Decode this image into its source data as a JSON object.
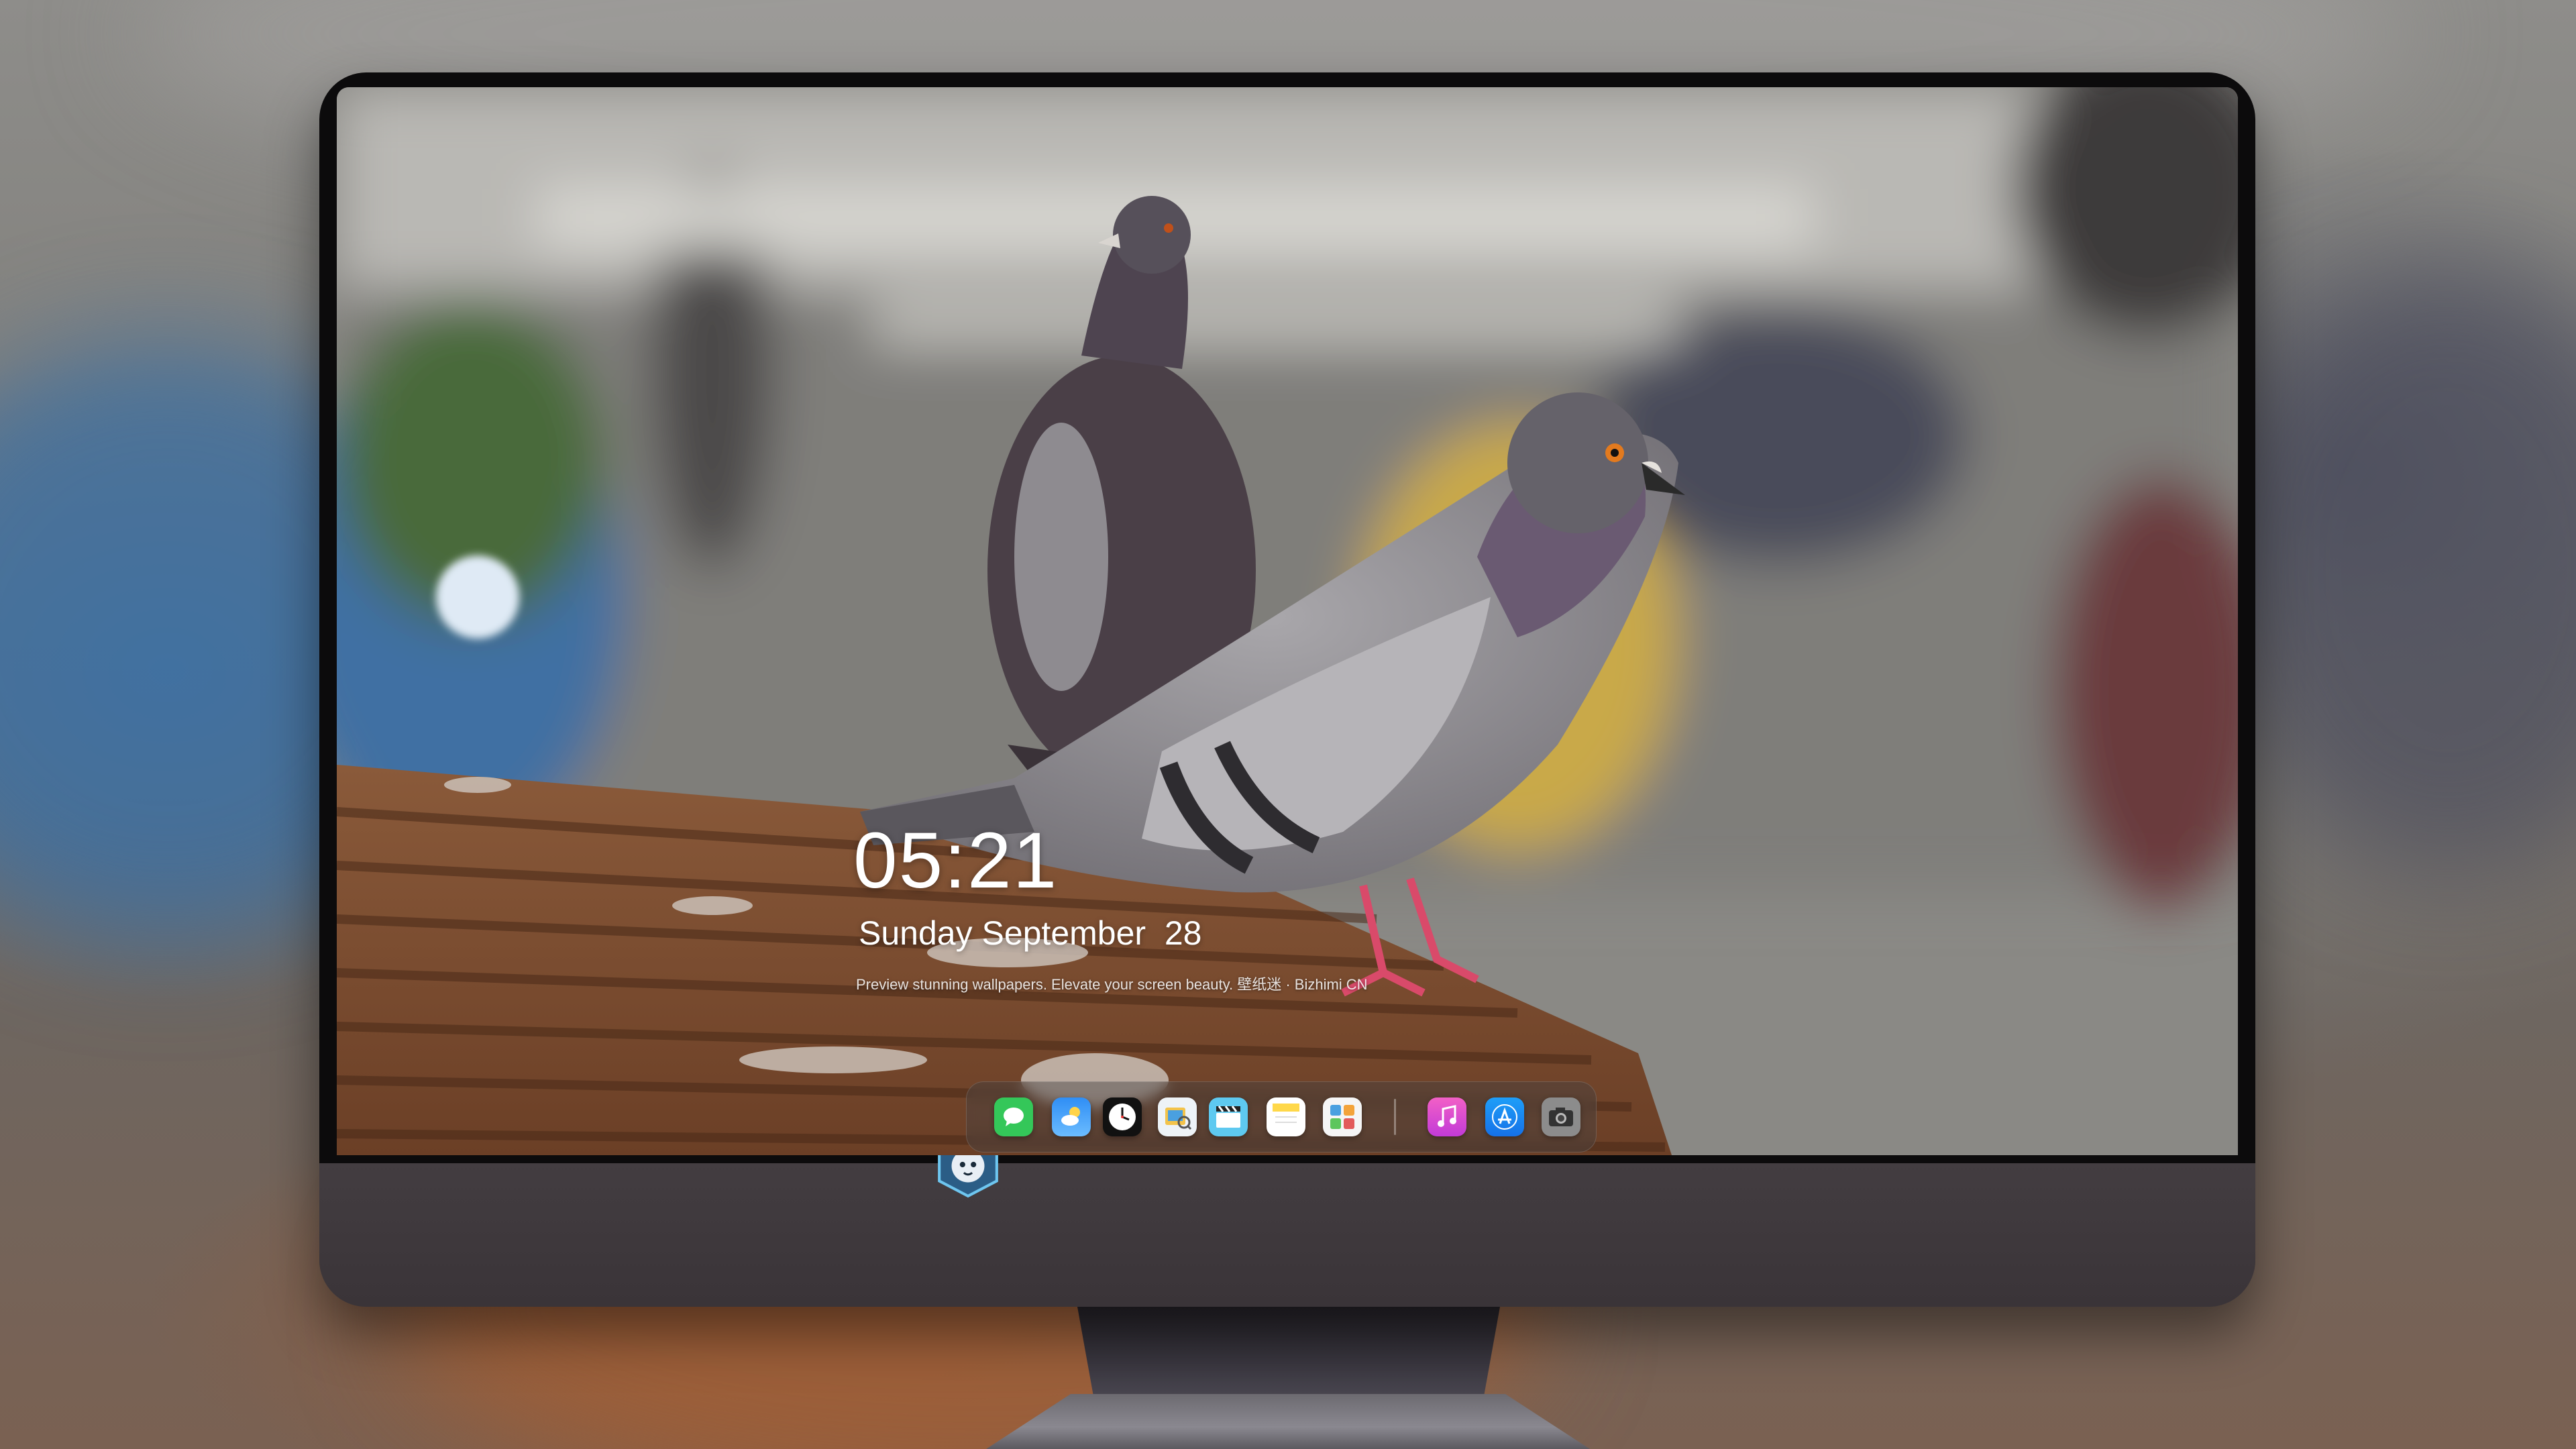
{
  "lockscreen": {
    "time": "05:21",
    "date": "Sunday September  28",
    "caption": "Preview stunning wallpapers. Elevate your screen beauty. 壁纸迷 · Bizhimi CN"
  },
  "dock": {
    "apps": [
      {
        "name": "messages",
        "icon": "speech-bubble",
        "color": "#34c759"
      },
      {
        "name": "weather",
        "icon": "cloud-sun",
        "color": "#3b9cf5"
      },
      {
        "name": "clock",
        "icon": "clock-face",
        "color": "#ffffff"
      },
      {
        "name": "preview",
        "icon": "photo-loupe",
        "color": "#f3c34a"
      },
      {
        "name": "clips",
        "icon": "clapperboard",
        "color": "#5ec9f0"
      },
      {
        "name": "notes",
        "icon": "notepad",
        "color": "#ffd84a"
      },
      {
        "name": "photos-widget",
        "icon": "widget-grid",
        "color": "#f5f5f5"
      },
      {
        "name": "music",
        "icon": "music-note",
        "color": "#e24dd3"
      },
      {
        "name": "app-store",
        "icon": "app-store-a",
        "color": "#1e8ef6"
      },
      {
        "name": "camera",
        "icon": "camera",
        "color": "#9a9a9a"
      }
    ]
  },
  "colors": {
    "monitor_body": "#3b3639",
    "bezel": "#0c0b0c",
    "text": "#ffffff"
  }
}
